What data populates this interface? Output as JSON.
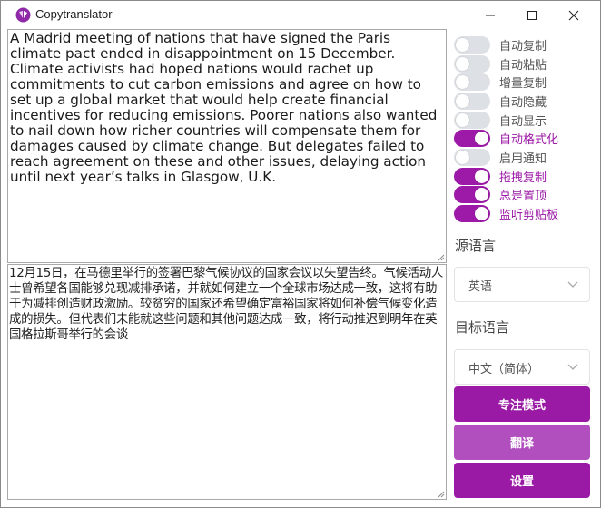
{
  "window": {
    "title": "Copytranslator"
  },
  "source_text": "A Madrid meeting of nations that have signed the Paris climate pact ended in disappointment on 15 December. Climate activists had hoped nations would rachet up commitments to cut carbon emissions and agree on how to set up a global market that would help create financial incentives for reducing emissions. Poorer nations also wanted to nail down how richer countries will compensate them for damages caused by climate change. But delegates failed to reach agreement on these and other issues, delaying action until next year’s talks in Glasgow, U.K.",
  "translated_text": "12月15日，在马德里举行的签署巴黎气候协议的国家会议以失望告终。气候活动人士曾希望各国能够兑现减排承诺，并就如何建立一个全球市场达成一致，这将有助于为减排创造财政激励。较贫穷的国家还希望确定富裕国家将如何补偿气候变化造成的损失。但代表们未能就这些问题和其他问题达成一致，将行动推迟到明年在英国格拉斯哥举行的会谈",
  "toggles": [
    {
      "label": "自动复制",
      "on": false
    },
    {
      "label": "自动粘贴",
      "on": false
    },
    {
      "label": "增量复制",
      "on": false
    },
    {
      "label": "自动隐藏",
      "on": false
    },
    {
      "label": "自动显示",
      "on": false
    },
    {
      "label": "自动格式化",
      "on": true
    },
    {
      "label": "启用通知",
      "on": false
    },
    {
      "label": "拖拽复制",
      "on": true
    },
    {
      "label": "总是置顶",
      "on": true
    },
    {
      "label": "监听剪贴板",
      "on": true
    }
  ],
  "source_language": {
    "label": "源语言",
    "value": "英语"
  },
  "target_language": {
    "label": "目标语言",
    "value": "中文（简体）"
  },
  "buttons": {
    "focus_mode": "专注模式",
    "translate": "翻译",
    "settings": "设置"
  },
  "colors": {
    "accent": "#9c1aa7",
    "focus_button": "#9a1aa5",
    "translate_button": "#b04fbd",
    "settings_button": "#9a1aa5",
    "toggle_off": "#dde0e4"
  }
}
